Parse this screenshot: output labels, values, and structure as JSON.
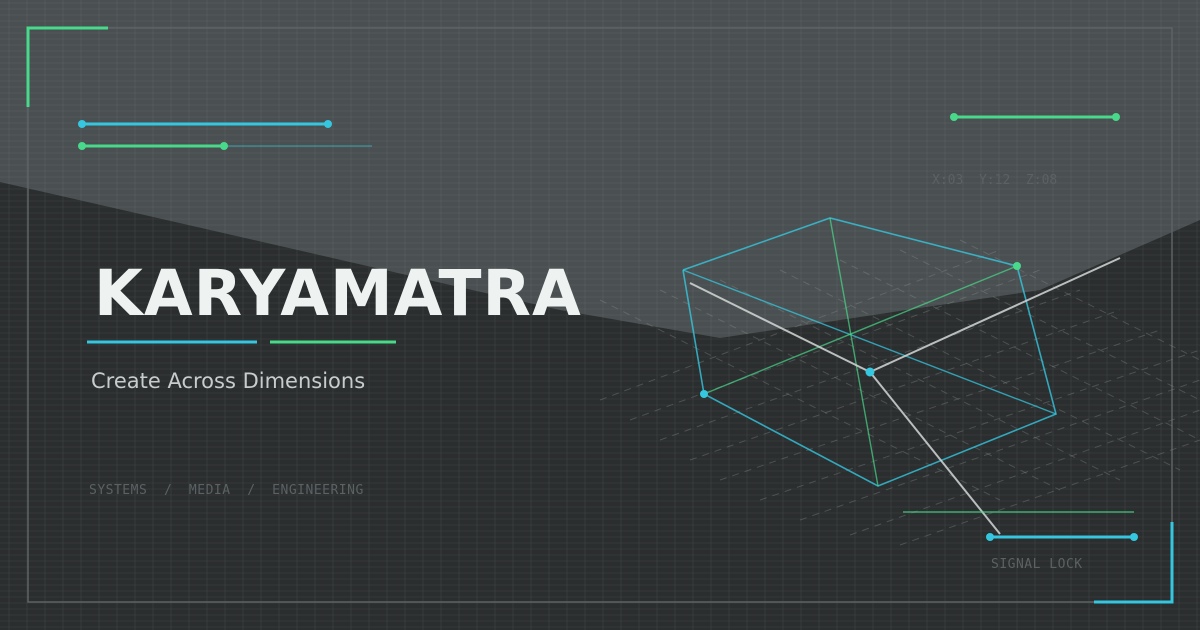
{
  "brand": {
    "title": "KARYAMATRA",
    "tagline": "Create Across Dimensions"
  },
  "categories": {
    "text": "SYSTEMS  /  MEDIA  /  ENGINEERING"
  },
  "hud": {
    "coords": "X:03  Y:12  Z:08",
    "status": "SIGNAL LOCK"
  },
  "colors": {
    "background": "#2b2e2f",
    "accent_cyan": "#35c7e0",
    "accent_green": "#48d98a",
    "title_text": "#eef3f1",
    "muted_text": "#5b6263"
  }
}
